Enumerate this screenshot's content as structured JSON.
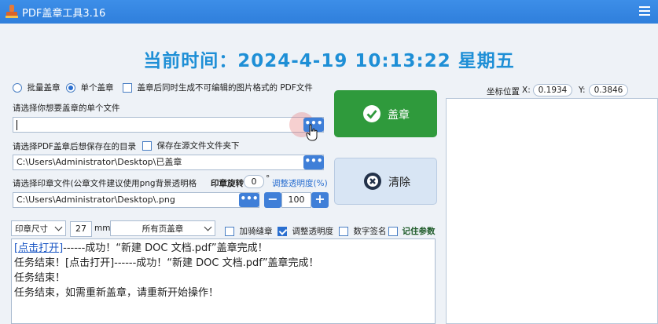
{
  "window": {
    "title": "PDF盖章工具3.16"
  },
  "clock": {
    "text": "当前时间：2024-4-19 10:13:22  星期五"
  },
  "mode": {
    "batch_label": "批量盖章",
    "single_label": "单个盖章",
    "selected": "single",
    "image_pdf_label": "盖章后同时生成不可编辑的图片格式的 PDF文件"
  },
  "file_select": {
    "label": "请选择你想要盖章的单个文件",
    "value": ""
  },
  "save_dir": {
    "label": "请选择PDF盖章后想保存在的目录",
    "save_in_source_label": "保存在源文件文件夹下",
    "value": "C:\\Users\\Administrator\\Desktop\\已盖章"
  },
  "stamp_file": {
    "label": "请选择印章文件(公章文件建议使用png背景透明格",
    "value": "C:\\Users\\Administrator\\Desktop\\.png",
    "rotate_label": "印章旋转",
    "rotate_value": "0",
    "degree_symbol": "°",
    "transparency_label": "调整透明度(%)",
    "transparency_value": "100",
    "minus": "−",
    "plus": "+"
  },
  "coords": {
    "label": "坐标位置",
    "x_label": "X:",
    "x_value": "0.1934",
    "y_label": "Y:",
    "y_value": "0.3846"
  },
  "buttons": {
    "stamp": "盖章",
    "clear": "清除",
    "dots": "•••"
  },
  "options": {
    "size_select": "印章尺寸",
    "size_value": "27",
    "size_unit": "mm",
    "page_select": "所有页盖章",
    "seam_label": "加骑缝章",
    "transparency_check_label": "调整透明度",
    "digital_sign_label": "数字签名",
    "remember_label": "记住参数",
    "transparency_checked": true
  },
  "log": {
    "line1_link": "[点击打开]",
    "line1_rest": "------成功！“新建 DOC 文档.pdf”盖章完成！",
    "line2": "任务结束！[点击打开]------成功！“新建 DOC 文档.pdf”盖章完成！",
    "line3": "任务结束！",
    "line4": "任务结束，如需重新盖章，请重新开始操作！"
  }
}
